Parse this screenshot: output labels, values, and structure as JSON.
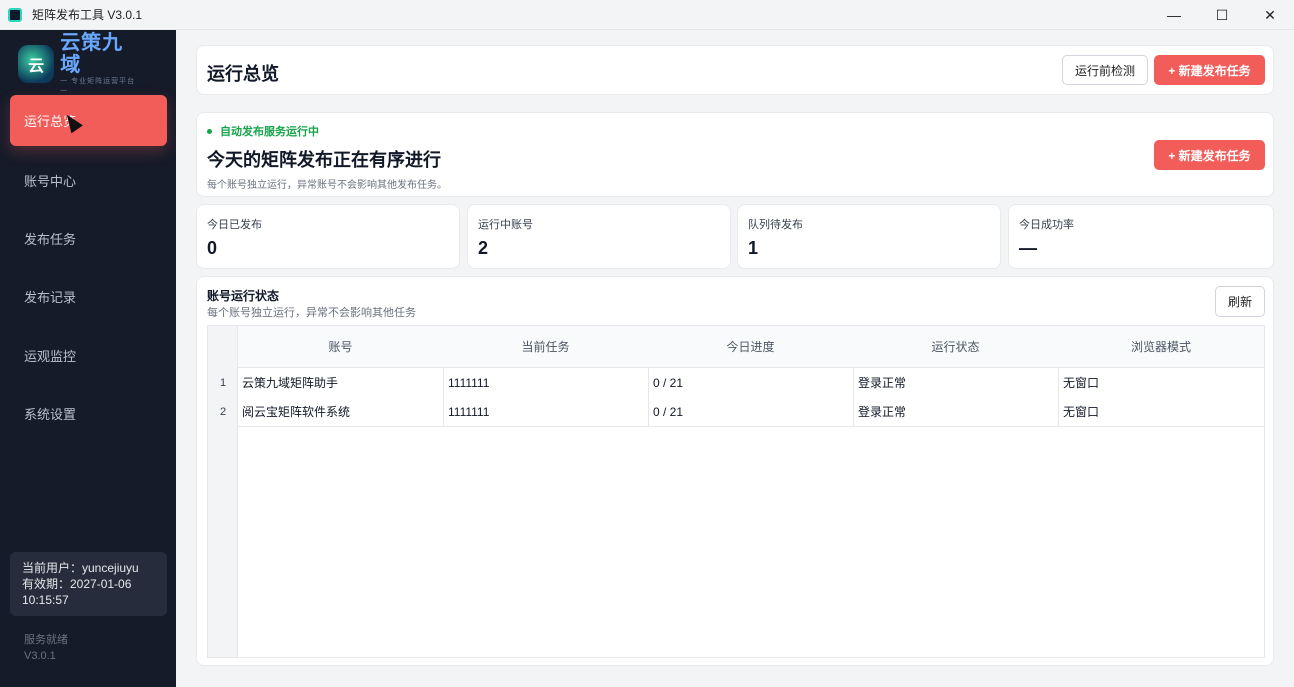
{
  "window": {
    "title": "矩阵发布工具 V3.0.1",
    "controls": {
      "minimize": "—",
      "maximize": "☐",
      "close": "✕"
    }
  },
  "sidebar": {
    "logo": {
      "mark": "云",
      "title": "云策九域",
      "subtitle": "一 专业矩阵运营平台 一"
    },
    "items": [
      {
        "label": "运行总览",
        "active": true
      },
      {
        "label": "账号中心"
      },
      {
        "label": "发布任务"
      },
      {
        "label": "发布记录"
      },
      {
        "label": "运观监控"
      },
      {
        "label": "系统设置"
      }
    ],
    "user": {
      "line1": "当前用户：yuncejiuyu",
      "line2": "有效期：2027-01-06",
      "line3": "10:15:57"
    },
    "service_status": "服务就绪",
    "version": "V3.0.1"
  },
  "header": {
    "title": "运行总览",
    "precheck_label": "运行前检测",
    "new_task_label": "+ 新建发布任务"
  },
  "status": {
    "indicator": "自动发布服务运行中",
    "title": "今天的矩阵发布正在有序进行",
    "desc": "每个账号独立运行，异常账号不会影响其他发布任务。",
    "new_task_label": "+ 新建发布任务"
  },
  "stats": [
    {
      "label": "今日已发布",
      "value": "0"
    },
    {
      "label": "运行中账号",
      "value": "2"
    },
    {
      "label": "队列待发布",
      "value": "1"
    },
    {
      "label": "今日成功率",
      "value": "—"
    }
  ],
  "accounts": {
    "title": "账号运行状态",
    "subtitle": "每个账号独立运行，异常不会影响其他任务",
    "refresh_label": "刷新",
    "columns": [
      "账号",
      "当前任务",
      "今日进度",
      "运行状态",
      "浏览器模式"
    ],
    "rows": [
      {
        "num": "1",
        "account": "云策九域矩阵助手",
        "task": "1111111",
        "progress": "0 / 21",
        "status": "登录正常",
        "mode": "无窗口"
      },
      {
        "num": "2",
        "account": "阅云宝矩阵软件系统",
        "task": "1111111",
        "progress": "0 / 21",
        "status": "登录正常",
        "mode": "无窗口"
      }
    ]
  },
  "colors": {
    "accent": "#f25d5a",
    "sidebar": "#161b29",
    "success": "#16a34a"
  }
}
